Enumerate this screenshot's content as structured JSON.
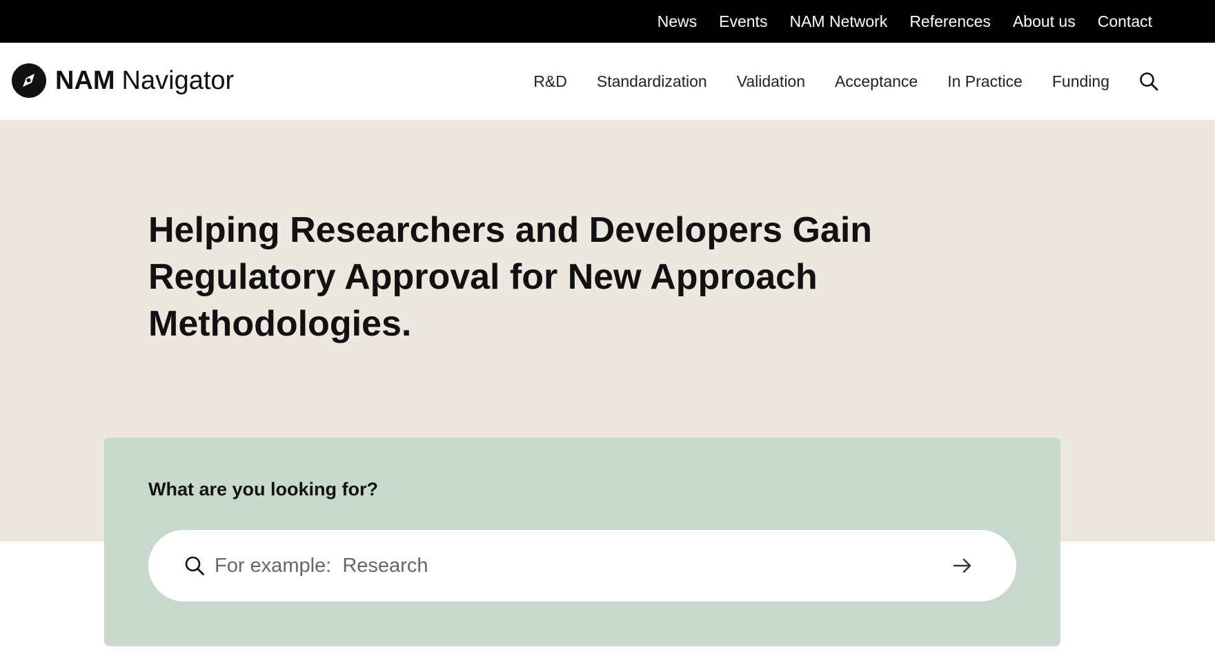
{
  "topbar": {
    "links": [
      "News",
      "Events",
      "NAM Network",
      "References",
      "About us",
      "Contact"
    ]
  },
  "header": {
    "logo": {
      "bold": "NAM",
      "light": "Navigator",
      "icon": "compass-icon"
    },
    "nav": [
      "R&D",
      "Standardization",
      "Validation",
      "Acceptance",
      "In Practice",
      "Funding"
    ],
    "search_icon": "search-icon"
  },
  "hero": {
    "title": "Helping Researchers and Developers Gain Regulatory Approval for New Approach Methodologies."
  },
  "search": {
    "heading": "What are you looking for?",
    "placeholder": "For example:  Research",
    "value": "",
    "search_icon": "search-icon",
    "submit_icon": "arrow-right-icon"
  },
  "colors": {
    "topbar_bg": "#000000",
    "hero_bg": "#ece7df",
    "search_card_bg": "#c7d9cd",
    "text": "#111111"
  }
}
